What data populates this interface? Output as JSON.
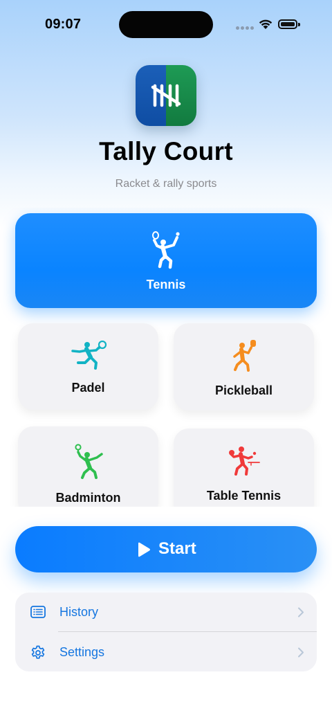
{
  "status_bar": {
    "time": "09:07"
  },
  "app": {
    "title": "Tally Court",
    "subtitle": "Racket & rally sports"
  },
  "sports": [
    {
      "label": "Tennis",
      "selected": true,
      "icon": "tennis-player-icon",
      "color": "#ffffff"
    },
    {
      "label": "Padel",
      "selected": false,
      "icon": "padel-player-icon",
      "color": "#12b3c4"
    },
    {
      "label": "Pickleball",
      "selected": false,
      "icon": "pickleball-player-icon",
      "color": "#f58d1f"
    },
    {
      "label": "Badminton",
      "selected": false,
      "icon": "badminton-player-icon",
      "color": "#2fbf4f"
    },
    {
      "label": "Table Tennis",
      "selected": false,
      "icon": "table-tennis-player-icon",
      "color": "#f03a3a"
    }
  ],
  "start_button": {
    "label": "Start",
    "icon": "play-icon"
  },
  "menu": [
    {
      "label": "History",
      "icon": "list-icon"
    },
    {
      "label": "Settings",
      "icon": "gear-icon"
    }
  ],
  "colors": {
    "accent": "#0a84ff",
    "link": "#1576e0"
  }
}
